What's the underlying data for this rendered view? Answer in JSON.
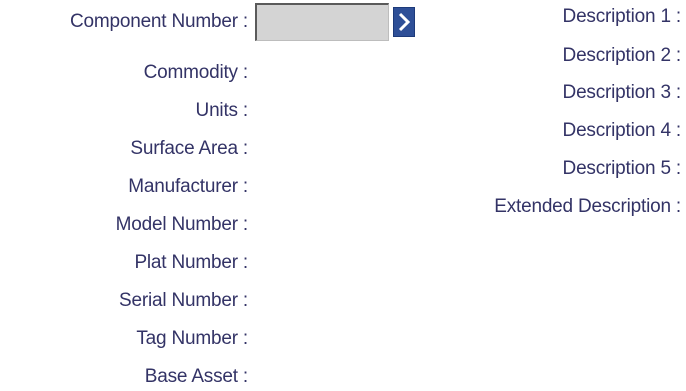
{
  "form": {
    "component_number_label": "Component Number :",
    "component_number_value": "",
    "prompt_icon": "chevron-right-icon",
    "left_labels": [
      "Commodity :",
      "Units :",
      "Surface Area :",
      "Manufacturer :",
      "Model Number :",
      "Plat Number :",
      "Serial Number :",
      "Tag Number :",
      "Base Asset :"
    ],
    "right_labels": [
      "Description 1 :",
      "Description 2 :",
      "Description 3 :",
      "Description 4 :",
      "Description 5 :",
      "Extended Description :"
    ]
  },
  "colors": {
    "label_text": "#333366",
    "input_background": "#d4d4d4",
    "prompt_button": "#2e4f97"
  }
}
